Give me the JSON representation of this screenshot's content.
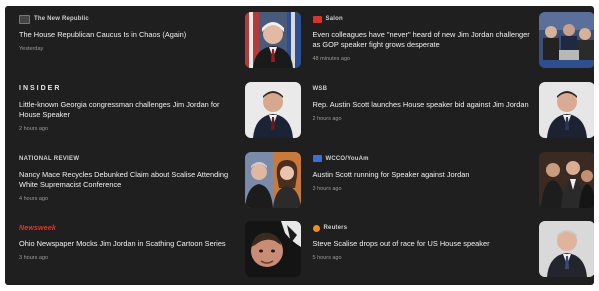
{
  "articles": [
    {
      "source": "The New Republic",
      "headline": "The House Republican Caucus Is in Chaos (Again)",
      "time": "Yesterday",
      "thumbnail_icon": "portrait-with-flags-photo",
      "logo_color": "#444444"
    },
    {
      "source": "Salon",
      "headline": "Even colleagues have \"never\" heard of new Jim Jordan challenger as GOP speaker fight grows desperate",
      "time": "48 minutes ago",
      "thumbnail_icon": "crowd-at-podium-photo",
      "logo_color": "#d9342b"
    },
    {
      "source": "INSIDER",
      "headline": "Little-known Georgia congressman challenges Jim Jordan for House Speaker",
      "time": "2 hours ago",
      "thumbnail_icon": "man-in-suit-photo",
      "logo_color": "#1f1f1f"
    },
    {
      "source": "WSB",
      "headline": "Rep. Austin Scott launches House speaker bid against Jim Jordan",
      "time": "2 hours ago",
      "thumbnail_icon": "man-in-suit-photo",
      "logo_color": "#ffffff"
    },
    {
      "source": "NATIONAL REVIEW",
      "headline": "Nancy Mace Recycles Debunked Claim about Scalise Attending White Supremacist Conference",
      "time": "4 hours ago",
      "thumbnail_icon": "two-portraits-photo",
      "logo_color": "#1f1f1f"
    },
    {
      "source": "WCCO/YouAm",
      "headline": "Austin Scott running for Speaker against Jordan",
      "time": "3 hours ago",
      "thumbnail_icon": "group-of-men-photo",
      "logo_color": "#3b6fd6"
    },
    {
      "source": "Newsweek",
      "headline": "Ohio Newspaper Mocks Jim Jordan in Scathing Cartoon Series",
      "time": "3 hours ago",
      "thumbnail_icon": "close-up-face-photo",
      "logo_color": "#1f1f1f"
    },
    {
      "source": "Reuters",
      "headline": "Steve Scalise drops out of race for US House speaker",
      "time": "5 hours ago",
      "thumbnail_icon": "man-in-suit-photo",
      "logo_color": "#f08a24"
    }
  ]
}
